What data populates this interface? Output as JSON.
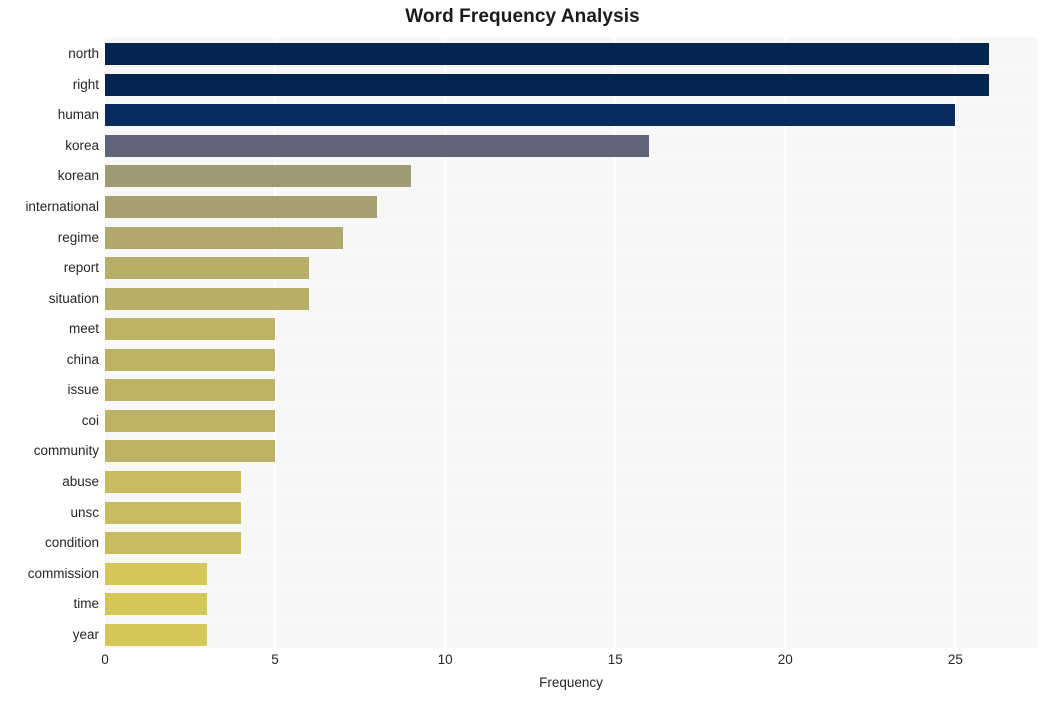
{
  "chart_data": {
    "type": "bar",
    "orientation": "horizontal",
    "title": "Word Frequency Analysis",
    "xlabel": "Frequency",
    "ylabel": "",
    "categories": [
      "north",
      "right",
      "human",
      "korea",
      "korean",
      "international",
      "regime",
      "report",
      "situation",
      "meet",
      "china",
      "issue",
      "coi",
      "community",
      "abuse",
      "unsc",
      "condition",
      "commission",
      "time",
      "year"
    ],
    "values": [
      26,
      26,
      25,
      16,
      9,
      8,
      7,
      6,
      6,
      5,
      5,
      5,
      5,
      5,
      4,
      4,
      4,
      3,
      3,
      3
    ],
    "bar_colors": [
      "#05244f",
      "#05244f",
      "#082b5e",
      "#63637a",
      "#9e9a74",
      "#a69f72",
      "#b0a86c",
      "#b7ae68",
      "#b7ae68",
      "#bdb365",
      "#bdb365",
      "#bdb365",
      "#bdb365",
      "#bdb365",
      "#c6bb5f",
      "#c6bb5f",
      "#c6bb5f",
      "#d4c657",
      "#d4c657",
      "#d4c657"
    ],
    "xlim": [
      0,
      27.4
    ],
    "xticks": [
      0,
      5,
      10,
      15,
      20,
      25
    ],
    "xticklabels": [
      "0",
      "5",
      "10",
      "15",
      "20",
      "25"
    ],
    "grid": true,
    "grid_axis": "x",
    "legend": null,
    "plot_background": "#f7f7f7",
    "figure_background": "#ffffff",
    "gridline_color": "#ffffff",
    "text_color": "#262626",
    "title_color": "#1a1a1a"
  }
}
